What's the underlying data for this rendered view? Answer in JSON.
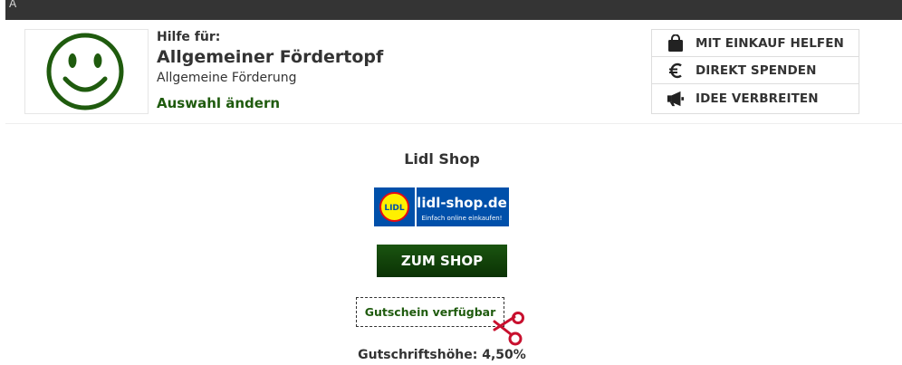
{
  "topbar": {
    "glyph": "A"
  },
  "header": {
    "help_label": "Hilfe für:",
    "title": "Allgemeiner Fördertopf",
    "subtitle": "Allgemeine Förderung",
    "change_link": "Auswahl ändern",
    "logo_icon": "smiley-face-icon",
    "logo_color": "#1f5b0e"
  },
  "actions": [
    {
      "label": "MIT EINKAUF HELFEN",
      "icon": "shopping-bag-icon"
    },
    {
      "label": "DIREKT SPENDEN",
      "icon": "euro-icon"
    },
    {
      "label": "IDEE VERBREITEN",
      "icon": "megaphone-icon"
    }
  ],
  "shop": {
    "title": "Lidl Shop",
    "logo_small_text": "LIDL",
    "logo_domain": "lidl-shop.de",
    "logo_tagline": "Einfach online einkaufen!",
    "button_label": "ZUM SHOP",
    "coupon_label": "Gutschein verfügbar",
    "credit_label": "Gutschriftshöhe: 4,50%"
  },
  "colors": {
    "brand_green": "#1f5b0e",
    "button_green": "#0e3b06",
    "lidl_blue": "#0050aa",
    "lidl_yellow": "#fff000",
    "lidl_red": "#e60a14",
    "scissors_red": "#c8102e"
  }
}
